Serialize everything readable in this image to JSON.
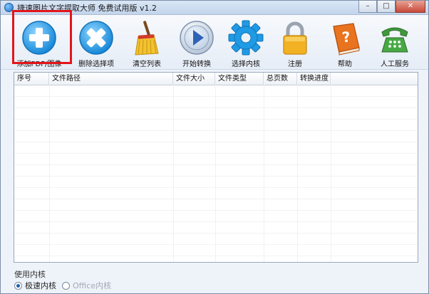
{
  "window": {
    "title": "捷速图片文字提取大师 免费试用版 v1.2",
    "controls": {
      "minimize": "–",
      "maximize": "□",
      "close": "✕"
    }
  },
  "toolbar": {
    "add": {
      "label": "添加PDF/图像",
      "icon": "plus-circle-icon",
      "color": "#2aa3e8"
    },
    "remove": {
      "label": "删除选择项",
      "icon": "x-circle-icon",
      "color": "#2aa3e8"
    },
    "clear": {
      "label": "清空列表",
      "icon": "broom-icon",
      "color": "#e8b21f"
    },
    "start": {
      "label": "开始转换",
      "icon": "play-icon",
      "color": "#3a73c6"
    },
    "engine": {
      "label": "选择内核",
      "icon": "gear-icon",
      "color": "#2aa3e8"
    },
    "register": {
      "label": "注册",
      "icon": "padlock-icon",
      "color": "#f2b01e"
    },
    "help": {
      "label": "帮助",
      "icon": "help-book-icon",
      "color": "#e86a1c"
    },
    "service": {
      "label": "人工服务",
      "icon": "telephone-icon",
      "color": "#3f9a3c"
    }
  },
  "table": {
    "columns": [
      "序号",
      "文件路径",
      "文件大小",
      "文件类型",
      "总页数",
      "转换进度"
    ],
    "rows": []
  },
  "engine_group": {
    "label": "使用内核",
    "options": [
      {
        "label": "极速内核",
        "selected": true
      },
      {
        "label": "Office内核",
        "selected": false
      }
    ]
  },
  "accent": {
    "highlight_border": "#e3151b"
  }
}
